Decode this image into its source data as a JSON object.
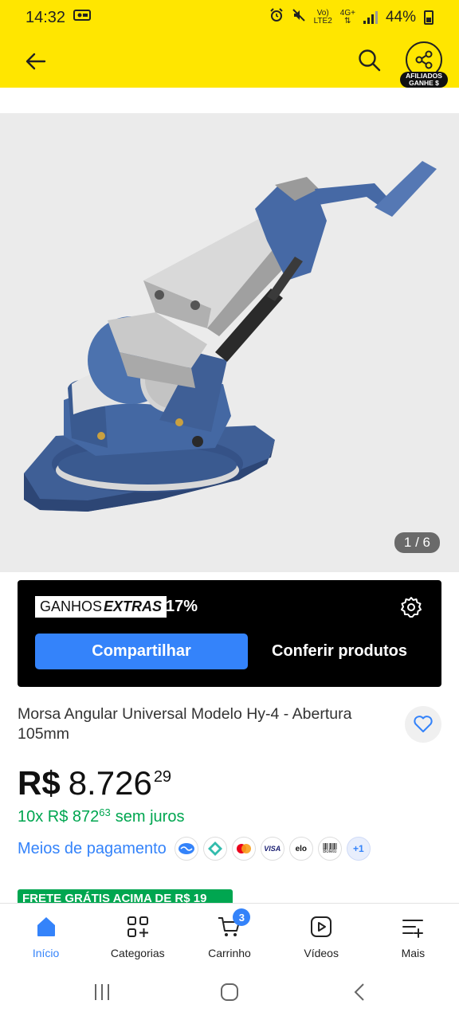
{
  "status_bar": {
    "time": "14:32",
    "network_top": "Vo)",
    "network_bottom": "LTE2",
    "network_gen": "4G+",
    "battery": "44%"
  },
  "header": {
    "affiliate_badge_line1": "AFILIADOS",
    "affiliate_badge_line2": "GANHE $"
  },
  "gallery": {
    "counter": "1 / 6"
  },
  "affiliate": {
    "ganhos_label": "GANHOS",
    "extras_label": "EXTRAS",
    "percent": "17%",
    "share_button": "Compartilhar",
    "check_products_button": "Conferir produtos"
  },
  "product": {
    "title": "Morsa Angular Universal Modelo Hy-4  - Abertura 105mm",
    "price_currency": "R$",
    "price_integer": "8.726",
    "price_cents": "29",
    "installments_prefix": "10x R$ 872",
    "installments_cents": "63",
    "installments_suffix": "sem juros",
    "payment_link": "Meios de pagamento",
    "payment_methods": [
      "VISA",
      "elo",
      "Boleto",
      "+1"
    ],
    "shipping_banner": "FRETE GRÁTIS ACIMA DE R$ 19"
  },
  "bottom_nav": {
    "items": [
      {
        "label": "Início",
        "icon": "home-icon"
      },
      {
        "label": "Categorias",
        "icon": "categories-icon"
      },
      {
        "label": "Carrinho",
        "icon": "cart-icon",
        "badge": "3"
      },
      {
        "label": "Vídeos",
        "icon": "video-icon"
      },
      {
        "label": "Mais",
        "icon": "more-icon"
      }
    ]
  },
  "colors": {
    "brand_yellow": "#ffe600",
    "accent_blue": "#3483fa",
    "success_green": "#00a650"
  }
}
